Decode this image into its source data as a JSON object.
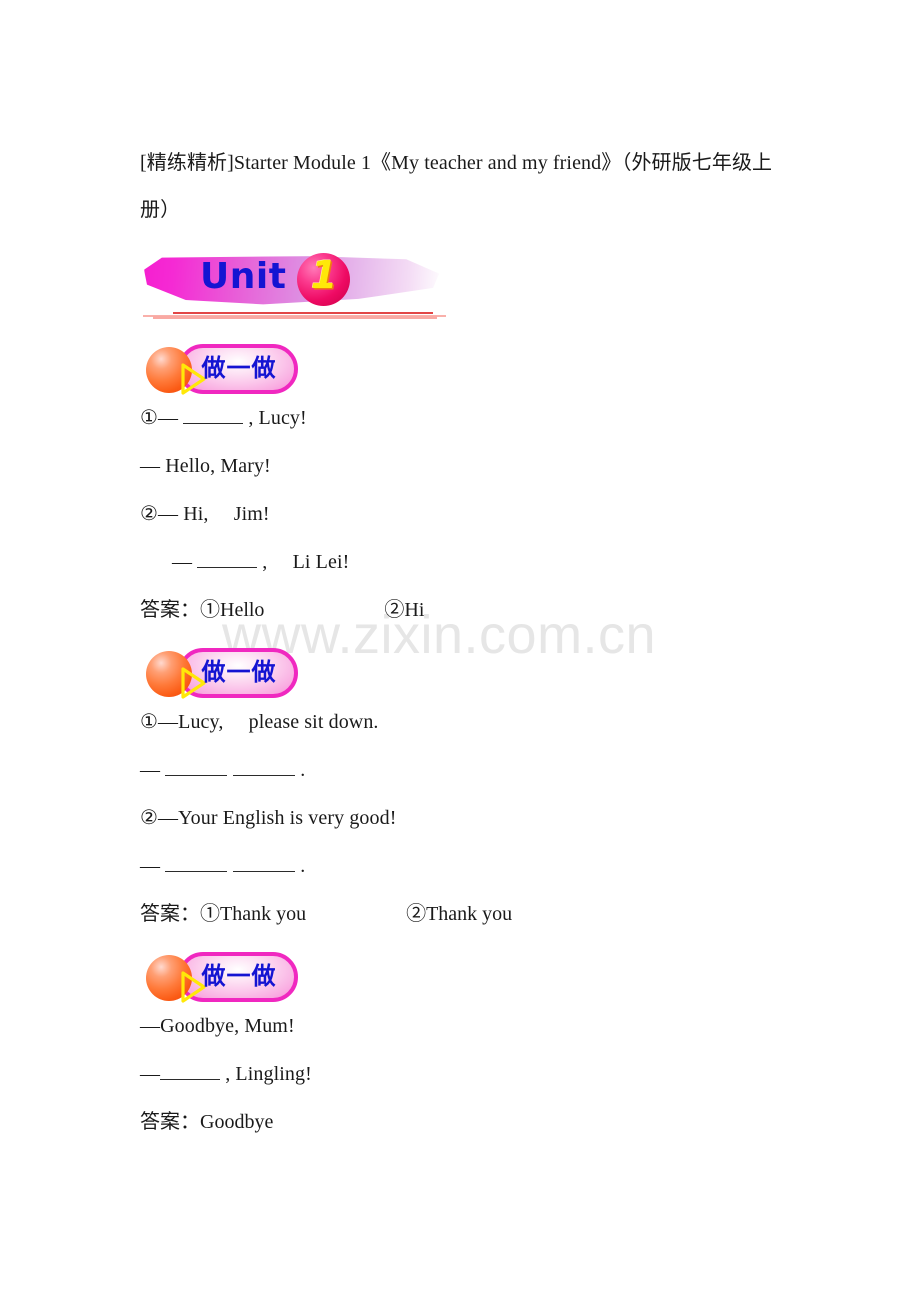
{
  "page": {
    "background_color": "#ffffff",
    "watermark": "www.zixin.com.cn",
    "watermark_color": "#e6e6e6"
  },
  "document": {
    "title": "[精练精析]Starter Module 1《My teacher and my friend》（外研版七年级上册）"
  },
  "unit_banner": {
    "word": "Unit",
    "number": "1",
    "colors": {
      "blob_start": "#f51fd0",
      "blob_end": "#ffffff",
      "word_color": "#1414d2",
      "circle_color": "#ee0a63",
      "number_color": "#ffe808",
      "rule_dark": "#e24646",
      "rule_light": "#f9a9a3"
    }
  },
  "exercises": [
    {
      "badge": {
        "label": "做一做",
        "icon": "play-triangle-icon",
        "pill_border_color": "#f028c0",
        "text_color": "#1414d2",
        "circle_color": "#ff7a3a",
        "triangle_color": "#ffe808"
      },
      "lines": [
        {
          "prefix": "①— ",
          "blanks": 1,
          "suffix": " , Lucy!",
          "indent": false
        },
        {
          "prefix": "— Hello, Mary!",
          "blanks": 0,
          "suffix": "",
          "indent": false
        },
        {
          "prefix": "②— Hi,　 Jim!",
          "blanks": 0,
          "suffix": "",
          "indent": false
        },
        {
          "prefix": "— ",
          "blanks": 1,
          "suffix": " ,　 Li Lei!",
          "indent": true
        }
      ],
      "answer": "答案：①Hello　　　　　　②Hi"
    },
    {
      "badge": {
        "label": "做一做",
        "icon": "play-triangle-icon",
        "pill_border_color": "#f028c0",
        "text_color": "#1414d2",
        "circle_color": "#ff7a3a",
        "triangle_color": "#ffe808"
      },
      "lines": [
        {
          "prefix": "①—Lucy,　 please sit down.",
          "blanks": 0,
          "suffix": "",
          "indent": false
        },
        {
          "prefix": "— ",
          "blanks": 2,
          "suffix": " .",
          "indent": false
        },
        {
          "prefix": "②—Your English is very good!",
          "blanks": 0,
          "suffix": "",
          "indent": false
        },
        {
          "prefix": "— ",
          "blanks": 2,
          "suffix": " .",
          "indent": false
        }
      ],
      "answer": "答案：①Thank you　　　　　②Thank you"
    },
    {
      "badge": {
        "label": "做一做",
        "icon": "play-triangle-icon",
        "pill_border_color": "#f028c0",
        "text_color": "#1414d2",
        "circle_color": "#ff7a3a",
        "triangle_color": "#ffe808"
      },
      "lines": [
        {
          "prefix": "—Goodbye, Mum!",
          "blanks": 0,
          "suffix": "",
          "indent": false
        },
        {
          "prefix": "—",
          "blanks": 1,
          "suffix": " , Lingling!",
          "indent": false
        }
      ],
      "answer": "答案：Goodbye"
    }
  ]
}
